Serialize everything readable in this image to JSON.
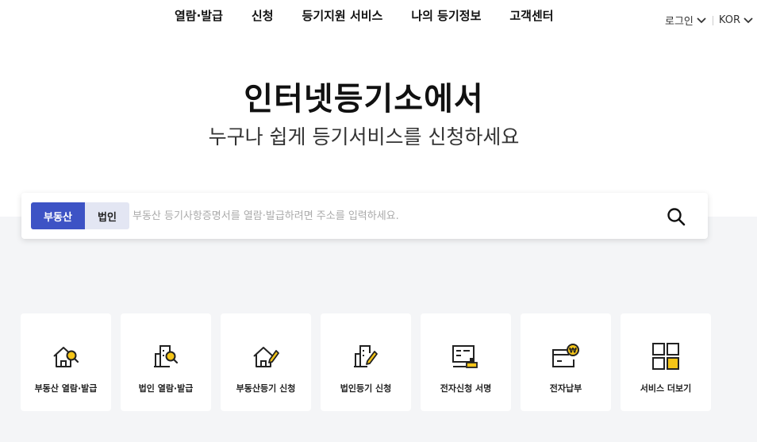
{
  "nav": {
    "items": [
      "열람·발급",
      "신청",
      "등기지원 서비스",
      "나의 등기정보",
      "고객센터"
    ]
  },
  "util": {
    "login": "로그인",
    "language": "KOR"
  },
  "hero": {
    "title": "인터넷등기소에서",
    "subtitle": "누구나 쉽게 등기서비스를 신청하세요"
  },
  "search": {
    "tabs": [
      "부동산",
      "법인"
    ],
    "active_tab": "부동산",
    "placeholder": "부동산 등기사항증명서를 열람·발급하려면 주소를 입력하세요.",
    "value": ""
  },
  "services": [
    {
      "label": "부동산 열람·발급",
      "icon": "house-search-icon"
    },
    {
      "label": "법인 열람·발급",
      "icon": "building-search-icon"
    },
    {
      "label": "부동산등기 신청",
      "icon": "house-edit-icon"
    },
    {
      "label": "법인등기 신청",
      "icon": "building-edit-icon"
    },
    {
      "label": "전자신청 서명",
      "icon": "stamp-sign-icon"
    },
    {
      "label": "전자납부",
      "icon": "won-payment-icon"
    },
    {
      "label": "서비스 더보기",
      "icon": "grid-more-icon"
    }
  ],
  "colors": {
    "accent": "#3d53c5",
    "tab_inactive": "#e3e6f3",
    "icon_highlight": "#f5c518",
    "background_gray": "#f4f5f7"
  }
}
